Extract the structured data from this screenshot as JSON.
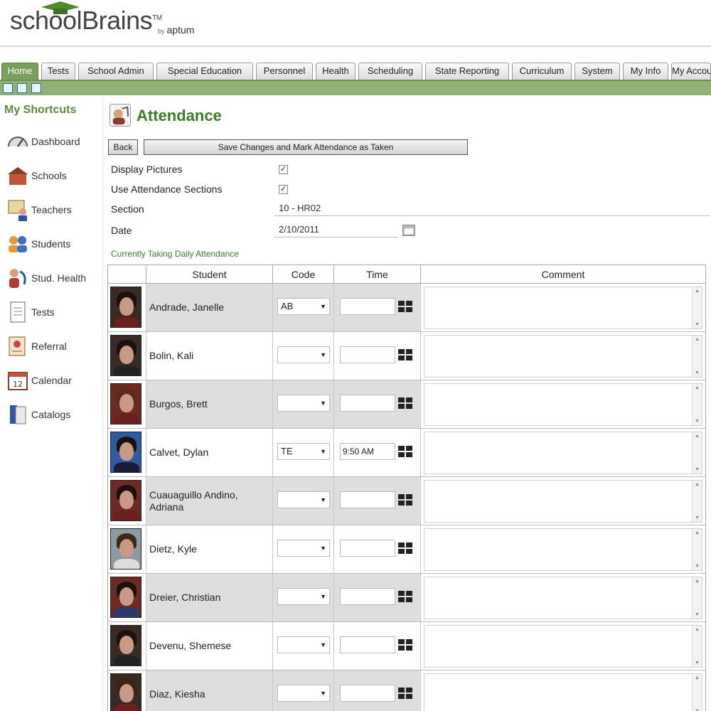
{
  "header": {
    "logo_text": "schoolBrains",
    "logo_tm": "TM",
    "byline_by": "by",
    "byline_company": "aptum"
  },
  "tabs": [
    "Home",
    "Tests",
    "School Admin",
    "Special Education",
    "Personnel",
    "Health",
    "Scheduling",
    "State Reporting",
    "Curriculum",
    "System",
    "My Info",
    "My Accounts"
  ],
  "sidebar": {
    "title": "My Shortcuts",
    "items": [
      {
        "label": "Dashboard",
        "icon": "gauge-icon"
      },
      {
        "label": "Schools",
        "icon": "schoolhouse-icon"
      },
      {
        "label": "Teachers",
        "icon": "teacher-icon"
      },
      {
        "label": "Students",
        "icon": "students-icon"
      },
      {
        "label": "Stud. Health",
        "icon": "stethoscope-icon"
      },
      {
        "label": "Tests",
        "icon": "document-icon"
      },
      {
        "label": "Referral",
        "icon": "referral-icon"
      },
      {
        "label": "Calendar",
        "icon": "calendar-icon"
      },
      {
        "label": "Catalogs",
        "icon": "catalog-icon"
      }
    ]
  },
  "page": {
    "title": "Attendance",
    "back_label": "Back",
    "save_label": "Save Changes and Mark Attendance as Taken",
    "display_pictures_label": "Display Pictures",
    "use_sections_label": "Use Attendance Sections",
    "section_label": "Section",
    "section_value": "10 - HR02",
    "date_label": "Date",
    "date_value": "2/10/2011",
    "currently_taking": "Currently Taking Daily Attendance"
  },
  "table": {
    "headers": [
      "",
      "Student",
      "Code",
      "Time",
      "Comment"
    ],
    "rows": [
      {
        "student": "Andrade, Janelle",
        "code": "AB",
        "time": ""
      },
      {
        "student": "Bolin, Kali",
        "code": "",
        "time": ""
      },
      {
        "student": "Burgos, Brett",
        "code": "",
        "time": ""
      },
      {
        "student": "Calvet, Dylan",
        "code": "TE",
        "time": "9:50 AM"
      },
      {
        "student": "Cuauaguillo Andino, Adriana",
        "code": "",
        "time": ""
      },
      {
        "student": "Dietz, Kyle",
        "code": "",
        "time": ""
      },
      {
        "student": "Dreier, Christian",
        "code": "",
        "time": ""
      },
      {
        "student": "Devenu, Shemese",
        "code": "",
        "time": ""
      },
      {
        "student": "Diaz, Kiesha",
        "code": "",
        "time": ""
      }
    ]
  },
  "colors": {
    "accent_green": "#3f7a2a",
    "tab_active": "#7ba05b",
    "subbar": "#8fb173"
  }
}
